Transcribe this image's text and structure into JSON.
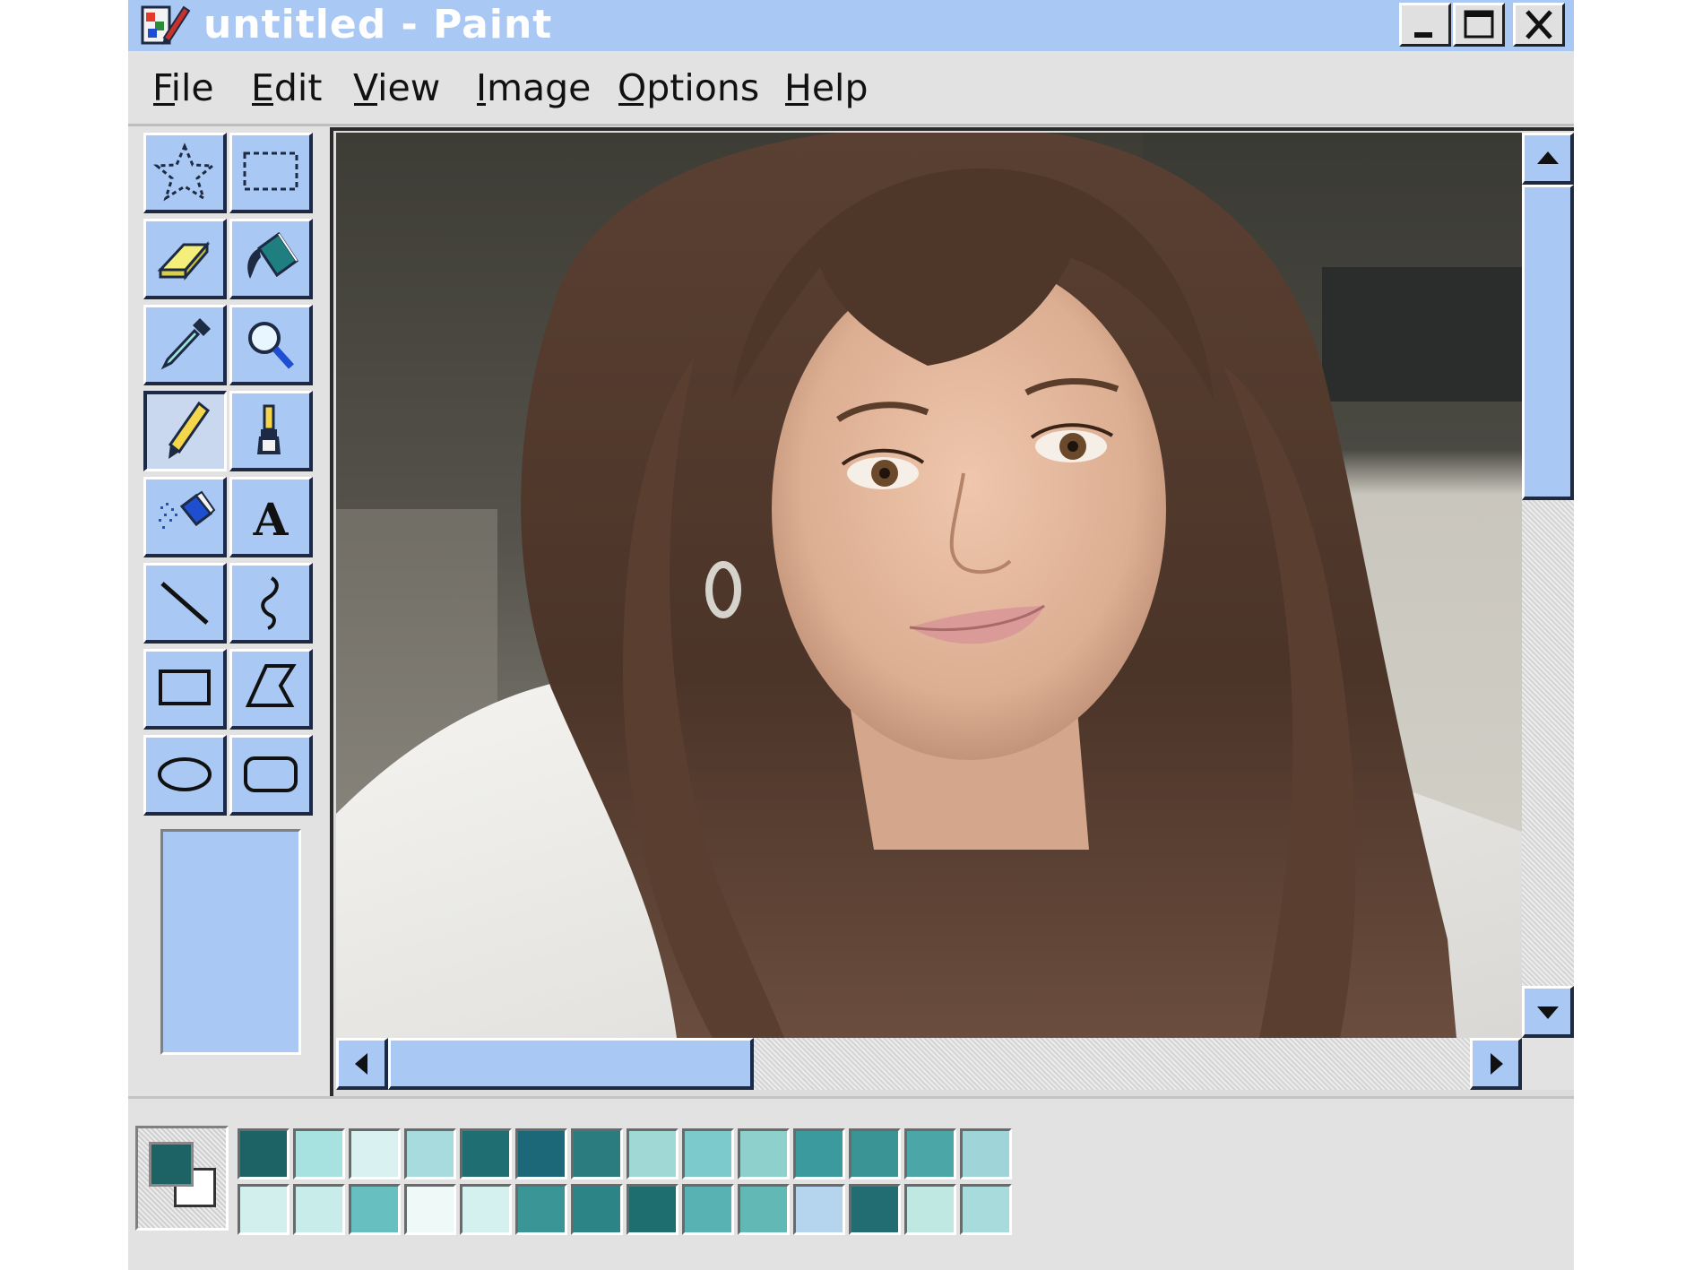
{
  "window": {
    "title": "untitled - Paint",
    "app_icon": "paint-app-icon",
    "controls": {
      "minimize_icon": "minimize-icon",
      "maximize_icon": "maximize-icon",
      "close_icon": "close-icon"
    }
  },
  "menu": [
    {
      "label": "File",
      "underline": "F"
    },
    {
      "label": "Edit",
      "underline": "E"
    },
    {
      "label": "View",
      "underline": "V"
    },
    {
      "label": "Image",
      "underline": "I"
    },
    {
      "label": "Options",
      "underline": "O"
    },
    {
      "label": "Help",
      "underline": "H"
    }
  ],
  "tools": [
    {
      "name": "free-form-select",
      "icon": "star-select-icon"
    },
    {
      "name": "select",
      "icon": "rect-select-icon"
    },
    {
      "name": "eraser",
      "icon": "eraser-icon"
    },
    {
      "name": "fill-with-color",
      "icon": "paint-bucket-icon"
    },
    {
      "name": "pick-color",
      "icon": "eyedropper-icon"
    },
    {
      "name": "magnifier",
      "icon": "magnifier-icon"
    },
    {
      "name": "pencil",
      "icon": "pencil-icon",
      "active": true
    },
    {
      "name": "brush",
      "icon": "brush-icon"
    },
    {
      "name": "airbrush",
      "icon": "airbrush-icon"
    },
    {
      "name": "text",
      "icon": "text-icon",
      "glyph": "A"
    },
    {
      "name": "line",
      "icon": "line-icon"
    },
    {
      "name": "curve",
      "icon": "curve-icon"
    },
    {
      "name": "rectangle",
      "icon": "rectangle-icon"
    },
    {
      "name": "polygon",
      "icon": "polygon-icon"
    },
    {
      "name": "ellipse",
      "icon": "ellipse-icon"
    },
    {
      "name": "rounded-rectangle",
      "icon": "rounded-rectangle-icon"
    }
  ],
  "canvas": {
    "content": "photo"
  },
  "colors": {
    "ui_accent": "#a9c8f3",
    "window_bg": "#e2e2e2",
    "foreground": "#1d6366",
    "background": "#ffffff",
    "palette_row1": [
      "#1d6366",
      "#a8e2e0",
      "#d9f2f1",
      "#a8dbde",
      "#1f6f72",
      "#1c6878",
      "#2a7c7e",
      "#9fd8d4",
      "#7dcacc",
      "#8ed0cc",
      "#3a9a9e",
      "#3a9496",
      "#4ba6a8",
      "#9fd4d8"
    ],
    "palette_row2": [
      "#d2eeed",
      "#c7ecea",
      "#68bfbf",
      "#eef9f8",
      "#d4f1ef",
      "#3a9597",
      "#2d8486",
      "#1e6e70",
      "#58b2b3",
      "#62b8b5",
      "#b5d4ee",
      "#226d71",
      "#bfe8e3",
      "#a8dcdc"
    ]
  },
  "scrollbars": {
    "vertical": {
      "up_icon": "arrow-up-icon",
      "down_icon": "arrow-down-icon",
      "position": 0.0,
      "visible_fraction": 0.35
    },
    "horizontal": {
      "left_icon": "arrow-left-icon",
      "right_icon": "arrow-right-icon",
      "position": 0.0,
      "visible_fraction": 0.29
    }
  }
}
